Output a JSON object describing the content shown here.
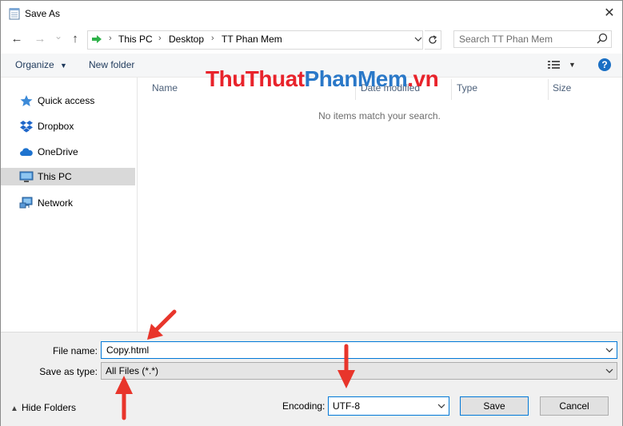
{
  "window": {
    "title": "Save As",
    "close_glyph": "✕"
  },
  "nav": {
    "back_glyph": "←",
    "forward_glyph": "→",
    "recent_glyph": "⌄",
    "up_glyph": "↑",
    "breadcrumb": [
      "This PC",
      "Desktop",
      "TT Phan Mem"
    ],
    "breadcrumb_sep": "›",
    "search_placeholder": "Search TT Phan Mem"
  },
  "toolbar": {
    "organize_label": "Organize",
    "new_folder_label": "New folder",
    "help_label": "?"
  },
  "sidebar": {
    "items": [
      {
        "label": "Quick access",
        "icon": "star-icon",
        "selected": false
      },
      {
        "label": "Dropbox",
        "icon": "dropbox-icon",
        "selected": false
      },
      {
        "label": "OneDrive",
        "icon": "cloud-icon",
        "selected": false
      },
      {
        "label": "This PC",
        "icon": "computer-icon",
        "selected": true
      },
      {
        "label": "Network",
        "icon": "network-icon",
        "selected": false
      }
    ]
  },
  "filelist": {
    "columns": [
      "Name",
      "Date modified",
      "Type",
      "Size"
    ],
    "empty_text": "No items match your search."
  },
  "watermark": {
    "part1": "ThuThuat",
    "part2": "PhanMem",
    "part3": ".vn"
  },
  "form": {
    "filename_label": "File name:",
    "filename_value": "Copy.html",
    "savetype_label": "Save as type:",
    "savetype_value": "All Files  (*.*)",
    "hide_folders_label": "Hide Folders",
    "encoding_label": "Encoding:",
    "encoding_value": "UTF-8",
    "save_label": "Save",
    "cancel_label": "Cancel"
  },
  "colors": {
    "annotation_arrow": "#e8352b",
    "accent": "#0078d7",
    "selected_item": "#d9d9d9"
  }
}
